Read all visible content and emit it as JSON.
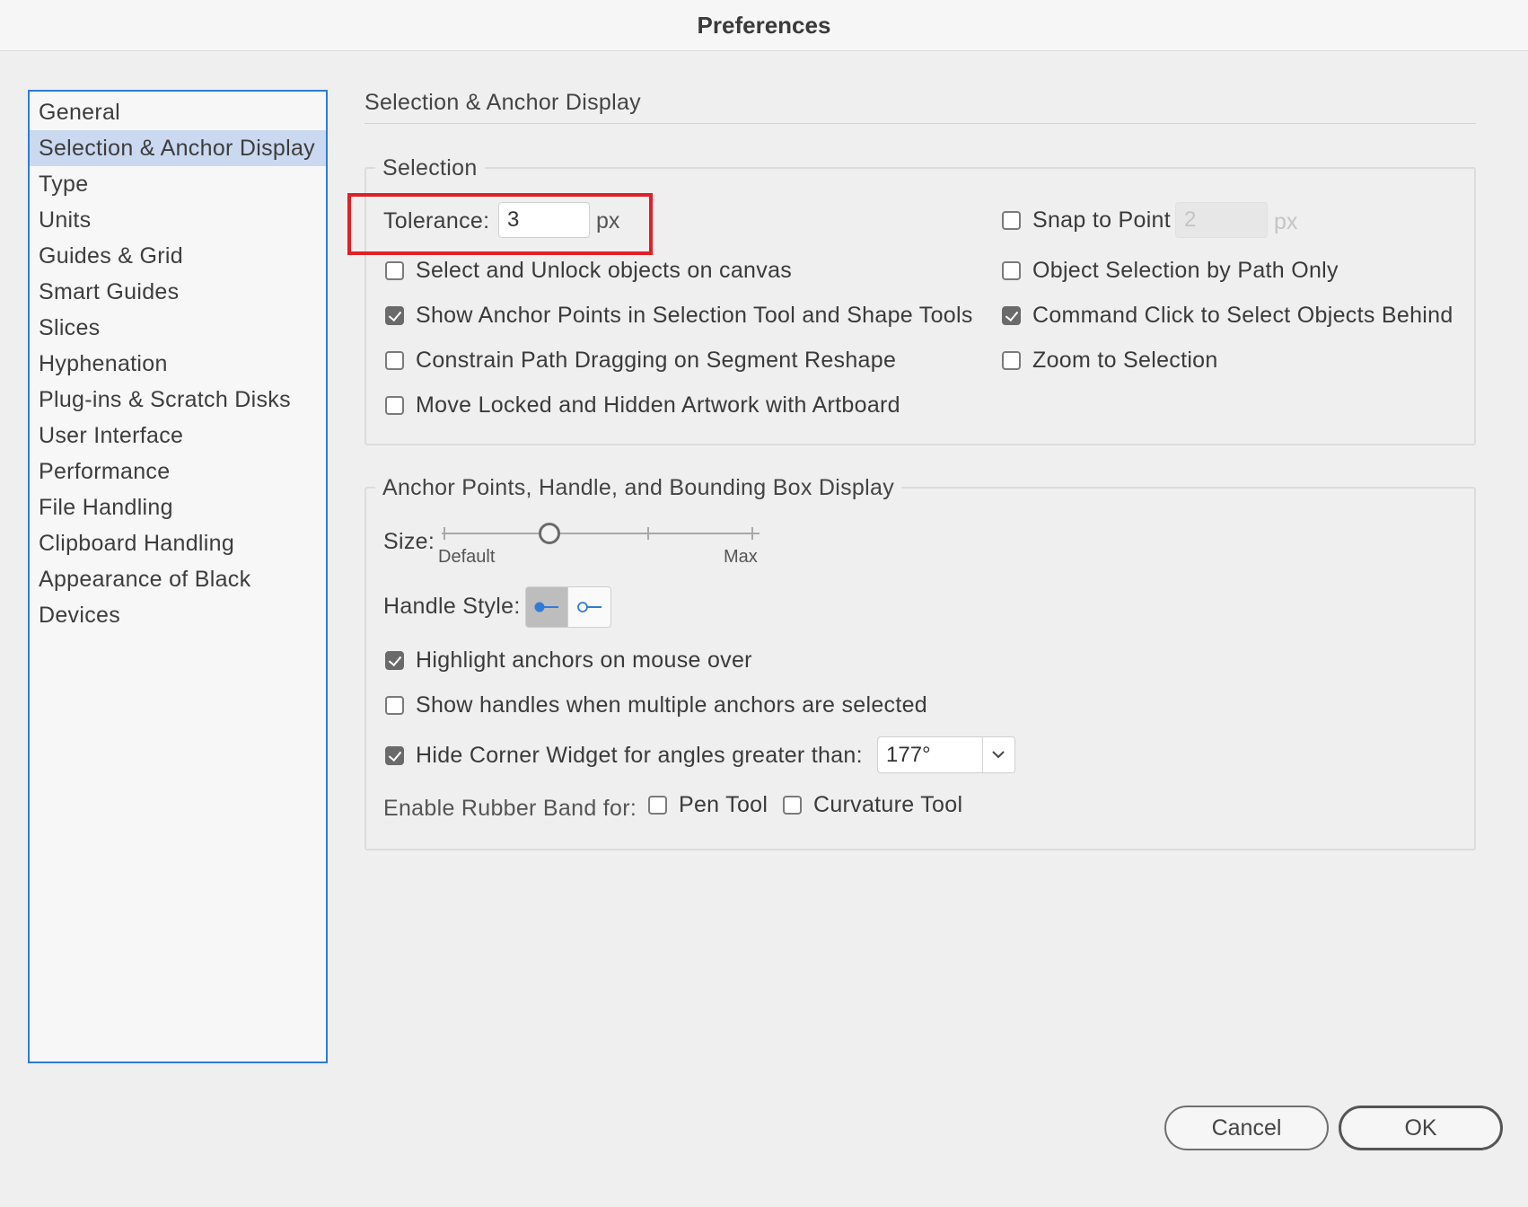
{
  "window": {
    "title": "Preferences"
  },
  "sidebar": {
    "items": [
      {
        "label": "General",
        "selected": false
      },
      {
        "label": "Selection & Anchor Display",
        "selected": true
      },
      {
        "label": "Type",
        "selected": false
      },
      {
        "label": "Units",
        "selected": false
      },
      {
        "label": "Guides & Grid",
        "selected": false
      },
      {
        "label": "Smart Guides",
        "selected": false
      },
      {
        "label": "Slices",
        "selected": false
      },
      {
        "label": "Hyphenation",
        "selected": false
      },
      {
        "label": "Plug-ins & Scratch Disks",
        "selected": false
      },
      {
        "label": "User Interface",
        "selected": false
      },
      {
        "label": "Performance",
        "selected": false
      },
      {
        "label": "File Handling",
        "selected": false
      },
      {
        "label": "Clipboard Handling",
        "selected": false
      },
      {
        "label": "Appearance of Black",
        "selected": false
      },
      {
        "label": "Devices",
        "selected": false
      }
    ]
  },
  "panel": {
    "heading": "Selection & Anchor Display"
  },
  "selection": {
    "legend": "Selection",
    "tolerance_label": "Tolerance:",
    "tolerance_value": "3",
    "tolerance_unit": "px",
    "snap_label": "Snap to Point",
    "snap_checked": false,
    "snap_value": "2",
    "snap_unit": "px",
    "options": [
      {
        "label": "Select and Unlock objects on canvas",
        "checked": false
      },
      {
        "label": "Show Anchor Points in Selection Tool and Shape Tools",
        "checked": true
      },
      {
        "label": "Constrain Path Dragging on Segment Reshape",
        "checked": false
      },
      {
        "label": "Move Locked and Hidden Artwork with Artboard",
        "checked": false
      }
    ],
    "options_right": [
      {
        "label": "Object Selection by Path Only",
        "checked": false
      },
      {
        "label": "Command Click to Select Objects Behind",
        "checked": true
      },
      {
        "label": "Zoom to Selection",
        "checked": false
      }
    ]
  },
  "anchor": {
    "legend": "Anchor Points, Handle, and Bounding Box Display",
    "size_label": "Size:",
    "size_min_label": "Default",
    "size_max_label": "Max",
    "size_level": 0.33,
    "handle_style_label": "Handle Style:",
    "handle_style_selected": "solid",
    "options": [
      {
        "label": "Highlight anchors on mouse over",
        "checked": true
      },
      {
        "label": "Show handles when multiple anchors are selected",
        "checked": false
      },
      {
        "label": "Hide Corner Widget for angles greater than:",
        "checked": true
      }
    ],
    "corner_angle": "177°",
    "rubber_band_label": "Enable Rubber Band for:",
    "pen_tool_label": "Pen Tool",
    "pen_tool_checked": false,
    "curvature_tool_label": "Curvature Tool",
    "curvature_tool_checked": false
  },
  "buttons": {
    "cancel": "Cancel",
    "ok": "OK"
  },
  "colors": {
    "accent": "#2f7bd8",
    "selected_item": "#cad9f0",
    "highlight": "#e01f26",
    "handle_blue": "#2f7bd8"
  },
  "icons": {
    "dropdown": "chevron-down-icon",
    "handle_solid": "handle-solid-icon",
    "handle_hollow": "handle-hollow-icon"
  }
}
